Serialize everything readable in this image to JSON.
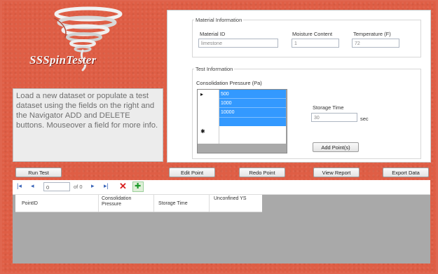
{
  "app": {
    "logo_text": "SSSpinTester",
    "info_text": "Load a new dataset or populate a test dataset using the fields on the right and the Navigator ADD and DELETE buttons. Mouseover a field for more info."
  },
  "material": {
    "legend": "Material Information",
    "material_id_label": "Material ID",
    "material_id_value": "limestone",
    "moisture_label": "Moisture Content",
    "moisture_value": "1",
    "temperature_label": "Temperature (F)",
    "temperature_value": "72"
  },
  "test": {
    "legend": "Test Information",
    "consolidation_label": "Consolidation Pressure (Pa)",
    "pressures": [
      "500",
      "1000",
      "10000"
    ],
    "current_row_marker": "▸",
    "new_row_marker": "✱",
    "storage_label": "Storage Time",
    "storage_value": "30",
    "storage_unit": "sec",
    "add_point_button": "Add Point(s)"
  },
  "actions": {
    "run_test": "Run Test",
    "edit_point": "Edit Point",
    "redo_point": "Redo Point",
    "view_report": "View Report",
    "export_data": "Export Data"
  },
  "navigator": {
    "first": "|◂",
    "prev": "◂",
    "position": "0",
    "of_label": "of 0",
    "next": "▸",
    "last": "▸|",
    "delete": "✕",
    "add": "✚"
  },
  "results": {
    "columns": [
      "PointID",
      "Consolidation Pressure",
      "Storage Time",
      "Unconfined YS"
    ]
  },
  "colors": {
    "frame": "#df5e45",
    "selection": "#3399ff",
    "grid_bg": "#a9a9a9",
    "nav_link": "#3a64b8",
    "delete_icon": "#d81f1f",
    "add_icon": "#1c9a2a"
  }
}
